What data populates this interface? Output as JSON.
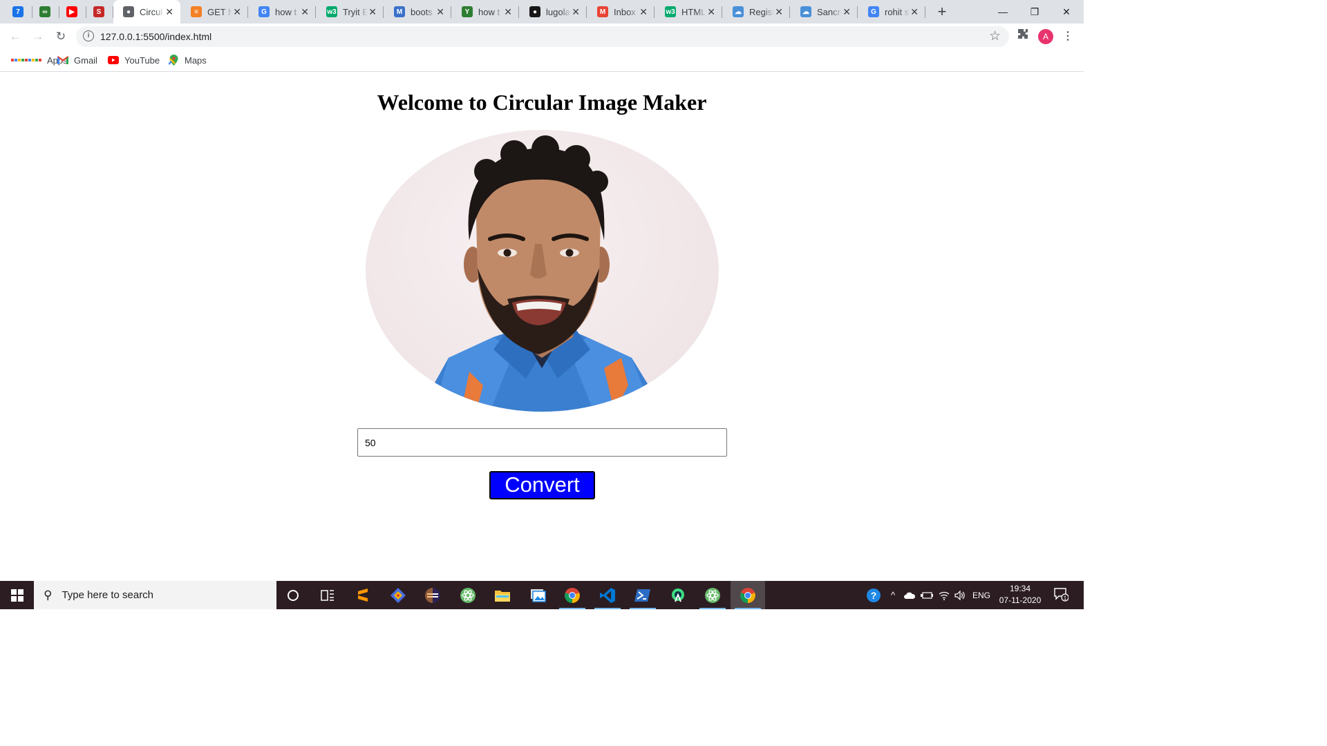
{
  "browser": {
    "tabs": [
      {
        "title": "",
        "icon": "calendar-icon",
        "color": "#1a73e8",
        "glyph": "7",
        "pinned": true
      },
      {
        "title": "",
        "icon": "infinity-icon",
        "color": "#2e7d32",
        "glyph": "∞",
        "pinned": true
      },
      {
        "title": "",
        "icon": "youtube-icon",
        "color": "#ff0000",
        "glyph": "▶",
        "pinned": true
      },
      {
        "title": "",
        "icon": "s-logo-icon",
        "color": "#c62828",
        "glyph": "S",
        "pinned": true
      },
      {
        "title": "Circul",
        "icon": "globe-icon",
        "color": "#5f6368",
        "glyph": "●",
        "active": true
      },
      {
        "title": "GET h",
        "icon": "stack-icon",
        "color": "#f48024",
        "glyph": "≡"
      },
      {
        "title": "how t",
        "icon": "google-icon",
        "color": "#4285f4",
        "glyph": "G"
      },
      {
        "title": "Tryit E",
        "icon": "w3-icon",
        "color": "#04aa6d",
        "glyph": "w3"
      },
      {
        "title": "boots",
        "icon": "mdb-icon",
        "color": "#3b71ca",
        "glyph": "M"
      },
      {
        "title": "how t",
        "icon": "xda-icon",
        "color": "#2e7d32",
        "glyph": "Y"
      },
      {
        "title": "lugola",
        "icon": "github-icon",
        "color": "#181717",
        "glyph": "●"
      },
      {
        "title": "Inbox",
        "icon": "gmail-icon",
        "color": "#ea4335",
        "glyph": "M"
      },
      {
        "title": "HTML",
        "icon": "w3-icon",
        "color": "#04aa6d",
        "glyph": "w3"
      },
      {
        "title": "Regist",
        "icon": "cloud-icon",
        "color": "#4a90d9",
        "glyph": "☁"
      },
      {
        "title": "Sancri",
        "icon": "cloud-icon",
        "color": "#4a90d9",
        "glyph": "☁"
      },
      {
        "title": "rohit s",
        "icon": "google-icon",
        "color": "#4285f4",
        "glyph": "G"
      }
    ],
    "new_tab": "+",
    "url": "127.0.0.1:5500/index.html",
    "profile_initial": "A",
    "bookmarks": [
      {
        "label": "Apps",
        "icon": "apps-grid-icon"
      },
      {
        "label": "Gmail",
        "icon": "gmail-icon"
      },
      {
        "label": "YouTube",
        "icon": "youtube-icon"
      },
      {
        "label": "Maps",
        "icon": "maps-icon"
      }
    ]
  },
  "page": {
    "heading": "Welcome to Circular Image Maker",
    "input_value": "50",
    "convert_label": "Convert",
    "accent_color": "#0000ff"
  },
  "taskbar": {
    "search_placeholder": "Type here to search",
    "apps": [
      "cortana-icon",
      "task-view-icon",
      "sublime-text-icon",
      "git-icon",
      "eclipse-icon",
      "atom-icon",
      "file-explorer-icon",
      "photos-icon",
      "chrome-icon",
      "vscode-icon",
      "powershell-icon",
      "android-studio-icon",
      "atom-icon",
      "chrome-icon"
    ],
    "language": "ENG",
    "time": "19:34",
    "date": "07-11-2020",
    "notification_count": "1"
  }
}
